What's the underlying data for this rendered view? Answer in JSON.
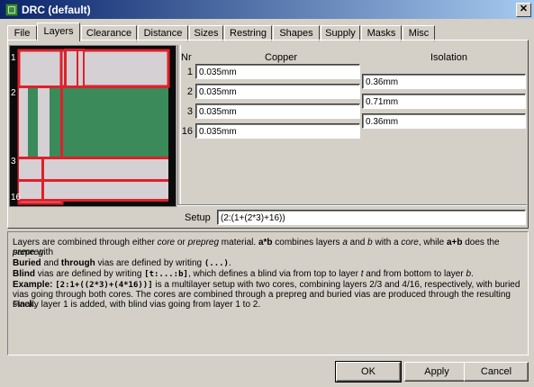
{
  "window": {
    "title": "DRC (default)",
    "close_symbol": "✕"
  },
  "tabs": [
    {
      "label": "File",
      "active": false
    },
    {
      "label": "Layers",
      "active": true
    },
    {
      "label": "Clearance",
      "active": false
    },
    {
      "label": "Distance",
      "active": false
    },
    {
      "label": "Sizes",
      "active": false
    },
    {
      "label": "Restring",
      "active": false
    },
    {
      "label": "Shapes",
      "active": false
    },
    {
      "label": "Supply",
      "active": false
    },
    {
      "label": "Masks",
      "active": false
    },
    {
      "label": "Misc",
      "active": false
    }
  ],
  "stack": {
    "layer_labels": [
      "1",
      "2",
      "3",
      "16"
    ],
    "colors": {
      "background": "#0b0b0b",
      "layer": "#d4d0d4",
      "copper": "#e0202a",
      "core": "#3a8a5a"
    }
  },
  "layers": {
    "nr_header": "Nr",
    "copper_header": "Copper",
    "isolation_header": "Isolation",
    "rows": [
      {
        "nr": "1",
        "copper": "0.035mm"
      },
      {
        "nr": "2",
        "copper": "0.035mm"
      },
      {
        "nr": "3",
        "copper": "0.035mm"
      },
      {
        "nr": "16",
        "copper": "0.035mm"
      }
    ],
    "isolation": [
      "0.36mm",
      "0.71mm",
      "0.36mm"
    ]
  },
  "setup": {
    "label": "Setup",
    "value": "(2:(1+(2*3)+16))"
  },
  "help": {
    "l1": [
      "Layers are combined through either ",
      "core",
      " or ",
      "prepreg",
      " material. ",
      "a*b",
      " combines layers ",
      "a",
      " and ",
      "b",
      " with a ",
      "core",
      ", while ",
      "a+b",
      " does the same with"
    ],
    "l2": "prepreg.",
    "l3": [
      "Buried",
      " and ",
      "through",
      " vias are defined by writing ",
      "(...)",
      "."
    ],
    "l4": [
      "Blind",
      " vias are defined by writing ",
      "[t:...:b]",
      ", which defines a blind via from top to layer ",
      "t",
      " and from bottom to layer ",
      "b",
      "."
    ],
    "l5": [
      "Example:",
      " ",
      "[2:1+((2*3)+(4*16))]",
      " is a multilayer setup with two cores, combining layers 2/3 and 4/16, respectively, with buried"
    ],
    "l6": "vias going through both cores. The cores are combined through a prepreg and buried vias are produced through the resulting stack.",
    "l7": "Finally layer 1 is added, with blind vias going from layer 1 to 2."
  },
  "buttons": {
    "ok": "OK",
    "apply": "Apply",
    "cancel": "Cancel"
  }
}
